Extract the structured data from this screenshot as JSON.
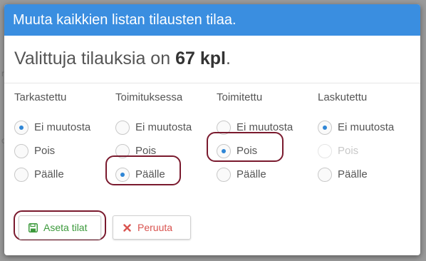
{
  "modal": {
    "title": "Muuta kaikkien listan tilausten tilaa.",
    "summary_prefix": "Valittuja tilauksia on",
    "summary_count": "67 kpl",
    "summary_suffix": "."
  },
  "groups": [
    {
      "title": "Tarkastettu",
      "options": [
        {
          "label": "Ei muutosta",
          "checked": true,
          "disabled": false
        },
        {
          "label": "Pois",
          "checked": false,
          "disabled": false
        },
        {
          "label": "Päälle",
          "checked": false,
          "disabled": false
        }
      ]
    },
    {
      "title": "Toimituksessa",
      "options": [
        {
          "label": "Ei muutosta",
          "checked": false,
          "disabled": false
        },
        {
          "label": "Pois",
          "checked": false,
          "disabled": false
        },
        {
          "label": "Päälle",
          "checked": true,
          "disabled": false
        }
      ]
    },
    {
      "title": "Toimitettu",
      "options": [
        {
          "label": "Ei muutosta",
          "checked": false,
          "disabled": false
        },
        {
          "label": "Pois",
          "checked": true,
          "disabled": false
        },
        {
          "label": "Päälle",
          "checked": false,
          "disabled": false
        }
      ]
    },
    {
      "title": "Laskutettu",
      "options": [
        {
          "label": "Ei muutosta",
          "checked": true,
          "disabled": false
        },
        {
          "label": "Pois",
          "checked": false,
          "disabled": true
        },
        {
          "label": "Päälle",
          "checked": false,
          "disabled": false
        }
      ]
    }
  ],
  "buttons": {
    "save_label": "Aseta tilat",
    "save_icon": "save-icon",
    "cancel_label": "Peruuta",
    "cancel_icon": "close-icon"
  },
  "colors": {
    "header_bg": "#3a8ee0",
    "radio_dot": "#2f86d6",
    "save_text": "#3c9a3c",
    "cancel_text": "#d9534f",
    "highlight": "#7a1a2e"
  }
}
